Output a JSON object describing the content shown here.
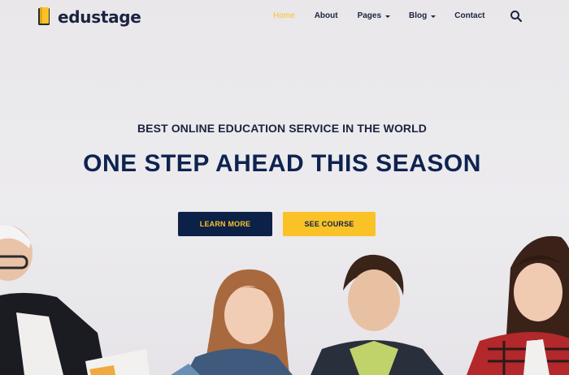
{
  "brand": {
    "name": "edustage"
  },
  "nav": {
    "items": [
      {
        "label": "Home",
        "active": true,
        "dropdown": false
      },
      {
        "label": "About",
        "active": false,
        "dropdown": false
      },
      {
        "label": "Pages",
        "active": false,
        "dropdown": true
      },
      {
        "label": "Blog",
        "active": false,
        "dropdown": true
      },
      {
        "label": "Contact",
        "active": false,
        "dropdown": false
      }
    ],
    "search_icon": "search-icon"
  },
  "hero": {
    "subtitle": "BEST ONLINE EDUCATION SERVICE IN THE WORLD",
    "title": "ONE STEP AHEAD THIS SEASON",
    "primary_button": "LEARN MORE",
    "secondary_button": "SEE COURSE"
  },
  "colors": {
    "accent": "#fbc227",
    "navy": "#0c2147",
    "text": "#1c2340",
    "background": "#ebe9ec"
  }
}
